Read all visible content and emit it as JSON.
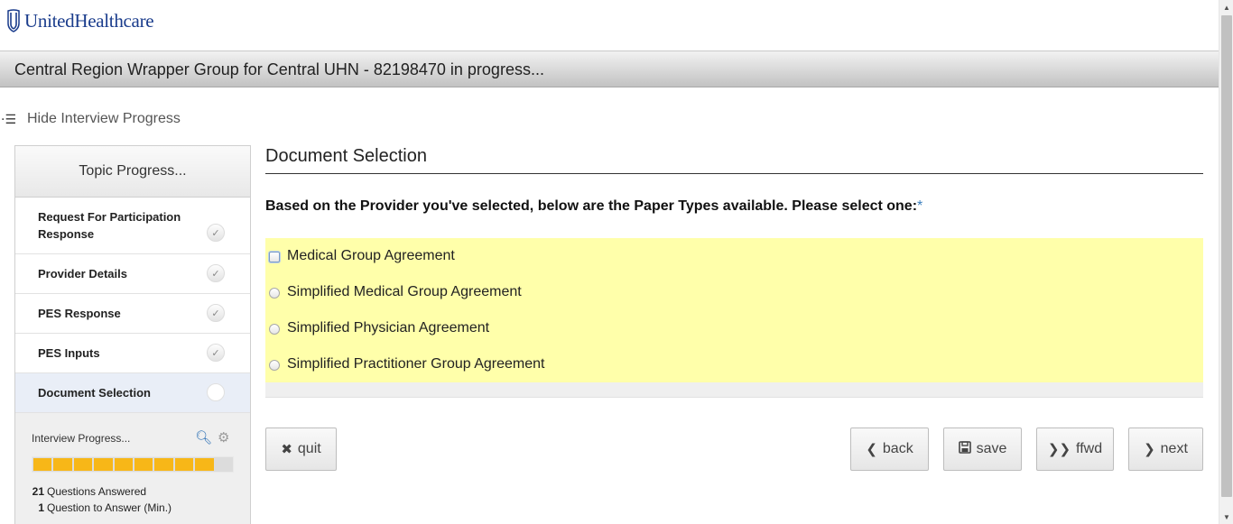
{
  "header": {
    "logo_text": "UnitedHealthcare",
    "banner_title": "Central Region Wrapper Group for Central UHN - 82198470 in progress..."
  },
  "progress_toggle": {
    "icon": "list-collapse-icon",
    "label": "Hide Interview Progress"
  },
  "sidebar": {
    "heading": "Topic Progress...",
    "topics": [
      {
        "label": "Request For Participation Response",
        "status": "complete"
      },
      {
        "label": "Provider Details",
        "status": "complete"
      },
      {
        "label": "PES Response",
        "status": "complete"
      },
      {
        "label": "PES Inputs",
        "status": "complete"
      },
      {
        "label": "Document Selection",
        "status": "current"
      }
    ],
    "interview_progress": {
      "title": "Interview Progress...",
      "segments_filled": 9,
      "segments_total": 10,
      "answered_count": "21",
      "answered_label": "Questions Answered",
      "remaining_count": "1",
      "remaining_label": "Question to Answer (Min.)"
    }
  },
  "main": {
    "section_title": "Document Selection",
    "prompt": "Based on the Provider you've selected, below are the Paper Types available. Please select one:",
    "required_marker": "*",
    "options": [
      {
        "label": "Medical Group Agreement"
      },
      {
        "label": "Simplified Medical Group Agreement"
      },
      {
        "label": "Simplified Physician Agreement"
      },
      {
        "label": "Simplified Practitioner Group Agreement"
      }
    ]
  },
  "buttons": {
    "quit": "quit",
    "back": "back",
    "save": "save",
    "ffwd": "ffwd",
    "next": "next"
  },
  "colors": {
    "options_background": "#ffffaa",
    "progress_fill": "#f7b718",
    "brand_blue": "#1a3c8c"
  }
}
